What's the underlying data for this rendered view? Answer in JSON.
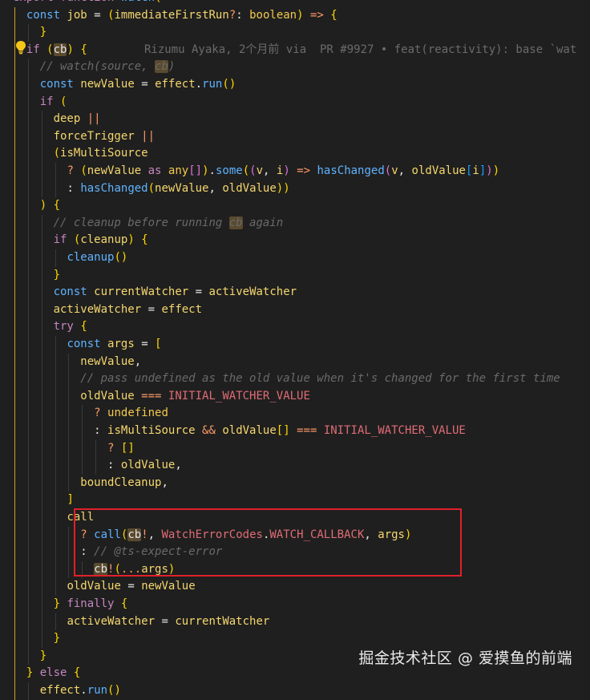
{
  "editor": {
    "language": "typescript",
    "theme_colors": {
      "background": "#1f1f1f",
      "keyword": "#c586c0",
      "function": "#5fb3ff",
      "comment": "#6a6a6a",
      "highlight_box": "#e0202a"
    },
    "blame": {
      "author": "Rizumu Ayaka",
      "time": "2个月前",
      "via": "via",
      "pr": "PR #9927",
      "bullet": "•",
      "message": "feat(reactivity): base `wat"
    },
    "lines": [
      "export function watch(",
      "  const job = (immediateFirstRun?: boolean) => {",
      "    }",
      "  if (cb) {",
      "    // watch(source, cb)",
      "    const newValue = effect.run()",
      "    if (",
      "      deep ||",
      "      forceTrigger ||",
      "      (isMultiSource",
      "        ? (newValue as any[]).some((v, i) => hasChanged(v, oldValue[i]))",
      "        : hasChanged(newValue, oldValue))",
      "    ) {",
      "      // cleanup before running cb again",
      "      if (cleanup) {",
      "        cleanup()",
      "      }",
      "      const currentWatcher = activeWatcher",
      "      activeWatcher = effect",
      "      try {",
      "        const args = [",
      "          newValue,",
      "          // pass undefined as the old value when it's changed for the first time",
      "          oldValue === INITIAL_WATCHER_VALUE",
      "            ? undefined",
      "            : isMultiSource && oldValue[0] === INITIAL_WATCHER_VALUE",
      "              ? []",
      "              : oldValue,",
      "          boundCleanup,",
      "        ]",
      "        call",
      "          ? call(cb!, WatchErrorCodes.WATCH_CALLBACK, args)",
      "          : // @ts-expect-error",
      "            cb!(...args)",
      "        oldValue = newValue",
      "      } finally {",
      "        activeWatcher = currentWatcher",
      "      }",
      "    }",
      "  } else {",
      "    effect.run()"
    ]
  },
  "watermark": "掘金技术社区 @ 爱摸鱼的前端"
}
